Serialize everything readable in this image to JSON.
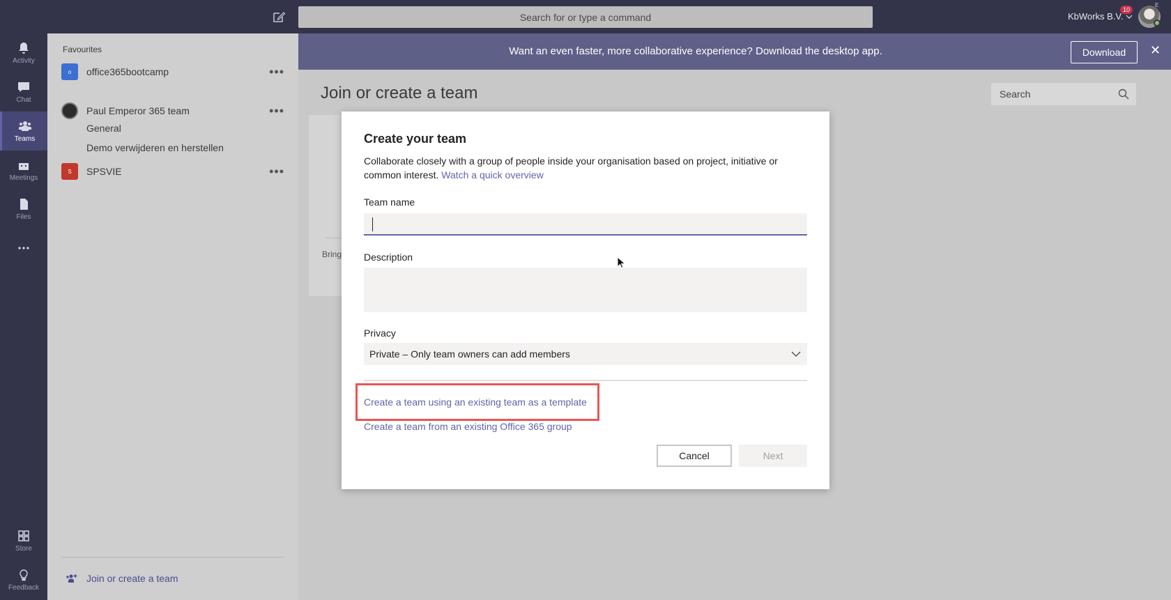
{
  "topbar": {
    "search_placeholder": "Search for or type a command",
    "org_name": "KbWorks B.V.",
    "notification_count": "10",
    "status_label": "E"
  },
  "rail": {
    "items": [
      {
        "label": "Activity",
        "icon": "bell-icon"
      },
      {
        "label": "Chat",
        "icon": "chat-icon"
      },
      {
        "label": "Teams",
        "icon": "teams-icon",
        "active": true
      },
      {
        "label": "Meetings",
        "icon": "calendar-icon"
      },
      {
        "label": "Files",
        "icon": "file-icon"
      },
      {
        "label": "Store",
        "icon": "store-icon"
      },
      {
        "label": "Feedback",
        "icon": "lightbulb-icon"
      }
    ]
  },
  "teams_panel": {
    "favourites_label": "Favourites",
    "teams": [
      {
        "name": "office365bootcamp",
        "initial": "o",
        "color": "#3b6fd1"
      },
      {
        "name": "Paul Emperor 365 team",
        "initial": "",
        "color": "#2b2b2b"
      },
      {
        "name": "SPSVIE",
        "initial": "S",
        "color": "#c0392b"
      }
    ],
    "channels": [
      "General",
      "Demo verwijderen en herstellen"
    ],
    "join_label": "Join or create a team"
  },
  "banner": {
    "text": "Want an even faster, more collaborative experience? Download the desktop app.",
    "download_label": "Download"
  },
  "main": {
    "title": "Join or create a team",
    "search_placeholder": "Search",
    "bg_card_text": "Bring"
  },
  "modal": {
    "title": "Create your team",
    "description": "Collaborate closely with a group of people inside your organisation based on project, initiative or common interest.",
    "overview_link": "Watch a quick overview",
    "team_name_label": "Team name",
    "team_name_value": "",
    "description_label": "Description",
    "description_value": "",
    "privacy_label": "Privacy",
    "privacy_value": "Private – Only team owners can add members",
    "template_link": "Create a team using an existing team as a template",
    "group_link": "Create a team from an existing Office 365 group",
    "cancel_label": "Cancel",
    "next_label": "Next"
  },
  "colors": {
    "accent": "#6264a7",
    "dark_bar": "#33344a",
    "highlight": "#e8574f"
  }
}
